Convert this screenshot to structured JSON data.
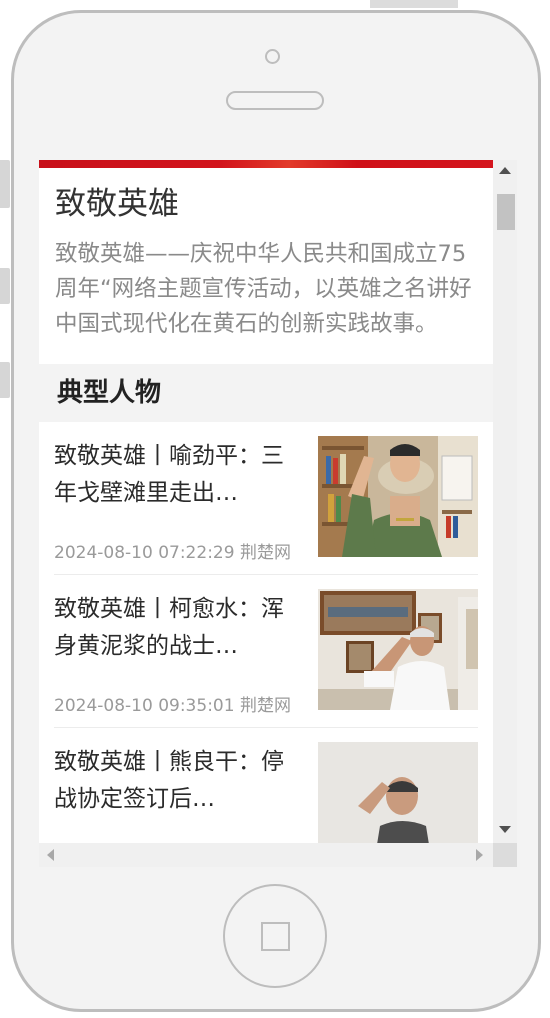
{
  "hero": {
    "title": "致敬英雄",
    "description": "致敬英雄——庆祝中华人民共和国成立75周年“网络主题宣传活动，以英雄之名讲好中国式现代化在黄石的创新实践故事。"
  },
  "section": {
    "title": "典型人物"
  },
  "articles": [
    {
      "title": "致敬英雄丨喻劲平：三年戈壁滩里走出…",
      "date": "2024-08-10 07:22:29",
      "source": "荆楚网",
      "thumb_icon": "photo-saluting-soldier"
    },
    {
      "title": "致敬英雄丨柯愈水：浑身黄泥浆的战士…",
      "date": "2024-08-10 09:35:01",
      "source": "荆楚网",
      "thumb_icon": "photo-saluting-veteran"
    },
    {
      "title": "致敬英雄丨熊良干：停战协定签订后…",
      "date": "",
      "source": "",
      "thumb_icon": "photo-saluting-man"
    }
  ],
  "colors": {
    "accent": "#d2141c",
    "title_text": "#333333",
    "muted_text": "#8a8a8a"
  }
}
